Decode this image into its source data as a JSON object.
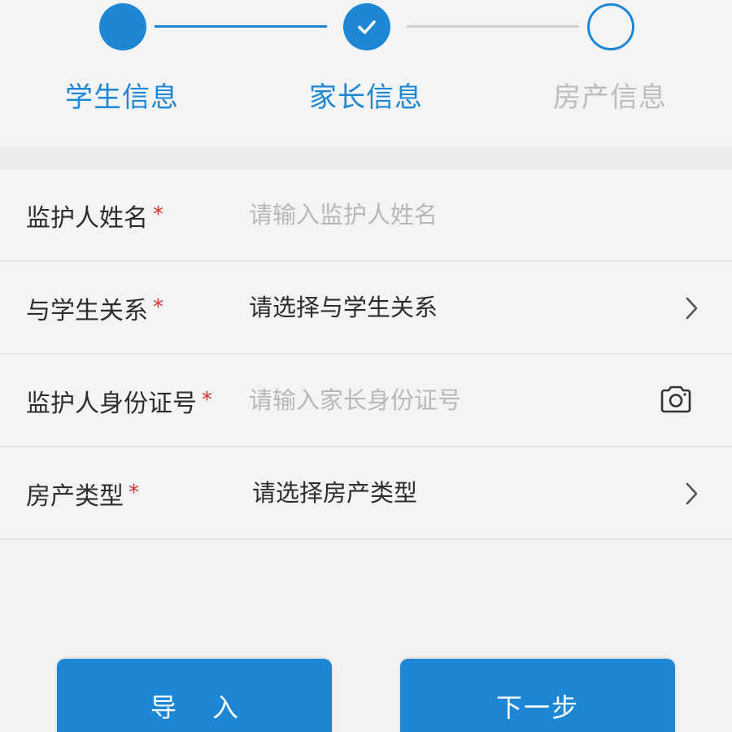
{
  "colors": {
    "primary": "#1d87d6",
    "inactive_line": "#cfcfcf",
    "inactive_text": "#bdbdbd",
    "required": "#d0342c"
  },
  "stepper": {
    "steps": [
      {
        "label": "学生信息",
        "state": "done"
      },
      {
        "label": "家长信息",
        "state": "done-checked"
      },
      {
        "label": "房产信息",
        "state": "pending"
      }
    ]
  },
  "form": {
    "rows": [
      {
        "label": "监护人姓名",
        "required": "*",
        "type": "input",
        "value": "",
        "placeholder": "请输入监护人姓名"
      },
      {
        "label": "与学生关系",
        "required": "*",
        "type": "select",
        "value": "请选择与学生关系",
        "icon": "chevron-right-icon"
      },
      {
        "label": "监护人身份证号",
        "required": "*",
        "type": "input",
        "value": "",
        "placeholder": "请输入家长身份证号",
        "icon": "camera-icon"
      },
      {
        "label": "房产类型",
        "required": "*",
        "type": "select",
        "value": "请选择房产类型",
        "icon": "chevron-right-icon"
      }
    ]
  },
  "actions": {
    "import_label": "导入",
    "next_label": "下一步"
  }
}
